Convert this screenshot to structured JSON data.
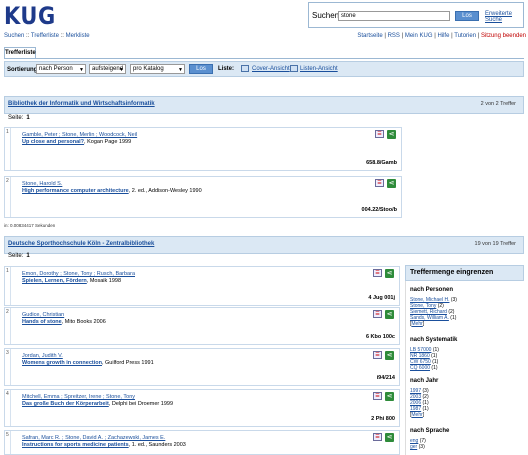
{
  "logo": "KUG",
  "topnav": {
    "items": [
      "Suchen",
      "Trefferliste",
      "Merkliste"
    ],
    "sep": " :: "
  },
  "search": {
    "label": "Suchen",
    "value": "stone",
    "button": "Los",
    "advanced": "Erweiterte Suche"
  },
  "rightnav": {
    "items": [
      "Startseite",
      "RSS",
      "Mein KUG",
      "Hilfe",
      "Tutorien"
    ],
    "end": "Sitzung beenden",
    "sep": " | "
  },
  "tab": "Trefferliste",
  "sortbar": {
    "label": "Sortierung:",
    "by": "nach Person",
    "order": "aufsteigend",
    "scope": "pro Katalog",
    "button": "Los",
    "liste_label": "Liste:",
    "cover": "Cover-Ansicht",
    "listview": "Listen-Ansicht"
  },
  "sections": [
    {
      "title": "Bibliothek der Informatik und Wirtschaftsinformatik",
      "count": "2 von 2 Treffer",
      "seite_label": "Seite:",
      "seite": "1",
      "records": [
        {
          "num": "1",
          "authors": "Gamble, Peter ; Stone, Merlin ; Woodcock, Neil",
          "title": "Up close and personal?",
          "rest": ", Kogan Page 1999",
          "sig": "658.8/Gamb"
        },
        {
          "num": "2",
          "authors": "Stone, Harold S.",
          "title": "High performance computer architecture",
          "rest": ", 2. ed., Addison-Wesley 1990",
          "sig": "004.22/Stoo/b"
        }
      ]
    },
    {
      "title": "Deutsche Sporthochschule Köln - Zentralbibliothek",
      "count": "19 von 19 Treffer",
      "seite_label": "Seite:",
      "seite": "1",
      "records": [
        {
          "num": "1",
          "authors": "Emon, Dorothy ; Stone, Tony ; Rusch, Barbara",
          "title": "Spielen, Lernen, Fördern",
          "rest": ", Mosaik 1998",
          "sig": "4 Jug 001j"
        },
        {
          "num": "2",
          "authors": "Gudice, Christian",
          "title": "Hands of stone",
          "rest": ", Mito Books 2006",
          "sig": "6 Kbo 100c"
        },
        {
          "num": "3",
          "authors": "Jordan, Judith V.",
          "title": "Womens growth in connection",
          "rest": ", Guilford Press 1991",
          "sig": "i94/214"
        },
        {
          "num": "4",
          "authors": "Mitchell, Emma ; Spreitzer, Irene ; Stone, Tony",
          "title": "Das große Buch der Körperarbeit",
          "rest": ", Delphi bei Droemer 1999",
          "sig": "2 Phi 800"
        },
        {
          "num": "5",
          "authors": "Safran, Marc R. ; Stone, David A. ; Zachazewski, James E.",
          "title": "Instructions for sports medicine patients",
          "rest": ", 1. ed., Saunders 2003",
          "sig": ""
        }
      ]
    }
  ],
  "timing": "in: 0.00834417 Sekunden",
  "facets": {
    "title": "Treffermenge eingrenzen",
    "groups": [
      {
        "head": "nach Personen",
        "items": [
          {
            "l": "Stone, Michael H.",
            "n": "(3)"
          },
          {
            "l": "Stone, Tony",
            "n": "(2)"
          },
          {
            "l": "Siemett, Richard",
            "n": "(2)"
          },
          {
            "l": "Sands, William A.",
            "n": "(1)"
          }
        ],
        "more": "Mehr"
      },
      {
        "head": "nach Systematik",
        "items": [
          {
            "l": "LB 57000",
            "n": "(1)"
          },
          {
            "l": "NR 1860",
            "n": "(1)"
          },
          {
            "l": "CW 6750",
            "n": "(1)"
          },
          {
            "l": "CQ 6000",
            "n": "(1)"
          }
        ],
        "more": ""
      },
      {
        "head": "nach Jahr",
        "items": [
          {
            "l": "1997",
            "n": "(3)"
          },
          {
            "l": "2003",
            "n": "(2)"
          },
          {
            "l": "2006",
            "n": "(1)"
          },
          {
            "l": "1987",
            "n": "(1)"
          }
        ],
        "more": "Mehr"
      },
      {
        "head": "nach Sprache",
        "items": [
          {
            "l": "eng",
            "n": "(7)"
          },
          {
            "l": "ger",
            "n": "(3)"
          }
        ],
        "more": ""
      }
    ]
  }
}
